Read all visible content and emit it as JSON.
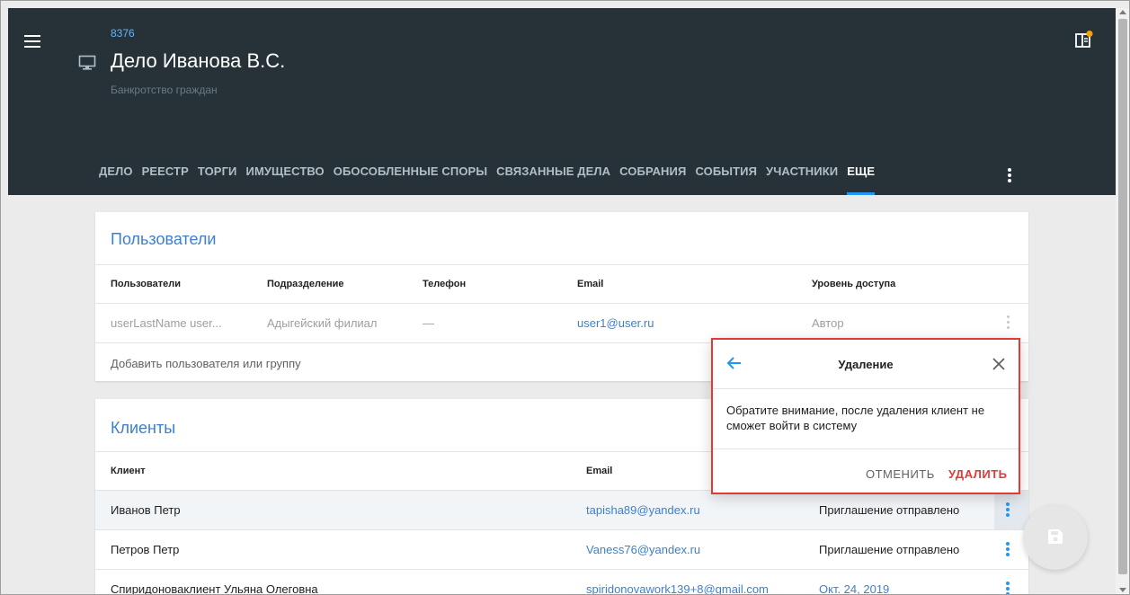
{
  "header": {
    "case_number": "8376",
    "title": "Дело Иванова В.С.",
    "subtitle": "Банкротство граждан"
  },
  "tabs": [
    {
      "label": "ДЕЛО"
    },
    {
      "label": "РЕЕСТР"
    },
    {
      "label": "ТОРГИ"
    },
    {
      "label": "ИМУЩЕСТВО"
    },
    {
      "label": "ОБОСОБЛЕННЫЕ СПОРЫ"
    },
    {
      "label": "СВЯЗАННЫЕ ДЕЛА"
    },
    {
      "label": "СОБРАНИЯ"
    },
    {
      "label": "СОБЫТИЯ"
    },
    {
      "label": "УЧАСТНИКИ"
    },
    {
      "label": "ЕЩЕ",
      "active": true
    }
  ],
  "users": {
    "title": "Пользователи",
    "columns": [
      "Пользователи",
      "Подразделение",
      "Телефон",
      "Email",
      "Уровень доступа"
    ],
    "rows": [
      {
        "name": "userLastName user...",
        "department": "Адыгейский филиал",
        "phone": "—",
        "email": "user1@user.ru",
        "access": "Автор"
      }
    ],
    "add_label": "Добавить пользователя или группу"
  },
  "clients": {
    "title": "Клиенты",
    "columns": [
      "Клиент",
      "Email"
    ],
    "rows": [
      {
        "name": "Иванов Петр",
        "email": "tapisha89@yandex.ru",
        "status": "Приглашение отправлено"
      },
      {
        "name": "Петров Петр",
        "email": "Vaness76@yandex.ru",
        "status": "Приглашение отправлено"
      },
      {
        "name": "Спиридоноваклиент Ульяна Олеговна",
        "email": "spiridonovawork139+8@gmail.com",
        "status": "Окт. 24, 2019"
      }
    ]
  },
  "dialog": {
    "title": "Удаление",
    "message": "Обратите внимание, после удаления клиент не сможет войти в систему",
    "cancel": "ОТМЕНИТЬ",
    "confirm": "УДАЛИТЬ"
  },
  "colors": {
    "header_bg": "#263238",
    "accent": "#2196f3",
    "link": "#3c7fd1",
    "danger": "#e53935"
  },
  "icons": [
    "menu-icon",
    "monitor-icon",
    "panel-icon",
    "more-vert-icon",
    "back-arrow-icon",
    "close-icon",
    "save-icon"
  ]
}
